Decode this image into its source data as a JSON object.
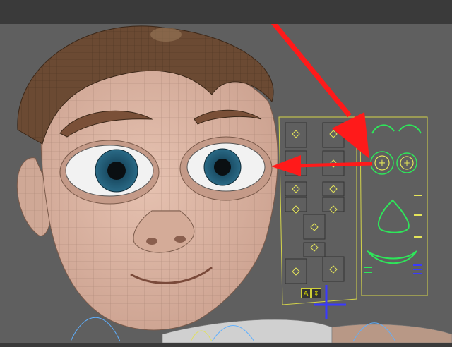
{
  "window": {
    "title": ""
  },
  "colors": {
    "viewport_bg": "#5f5f5f",
    "skin": "#d8b4a3",
    "hair": "#6b4a33",
    "iris": "#2a6a86",
    "panel_outline": "#d4d44a",
    "control_outline": "#2ee65a",
    "annotation_arrow": "#ff1a1a"
  },
  "facial_rig_panel": {
    "left_panel_controls": 8,
    "right_panel": {
      "eyes": [
        {
          "name": "eye-left-control",
          "symbol": "+"
        },
        {
          "name": "eye-right-control",
          "symbol": "+"
        }
      ]
    },
    "toggle_buttons": [
      {
        "name": "toggle-a-button",
        "label": "A"
      },
      {
        "name": "toggle-arrows-button",
        "label": "⇕"
      }
    ]
  },
  "icons": [
    "eyebrow-control-icon",
    "nose-control-icon",
    "mouth-control-icon",
    "move-cross-icon",
    "annotation-arrow-icon"
  ]
}
